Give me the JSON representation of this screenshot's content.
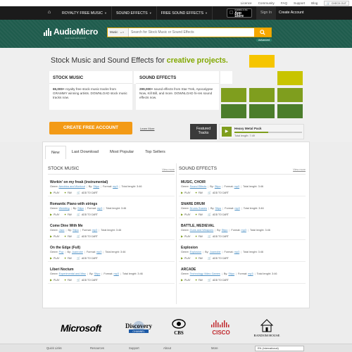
{
  "utility": {
    "links": [
      "Licence",
      "Community",
      "FAQ",
      "Support",
      "Blog"
    ],
    "cart_label": "CHECK OUT"
  },
  "nav": {
    "items": [
      "ROYALTY FREE MUSIC",
      "SOUND EFFECTS",
      "FREE SOUND EFFECTS"
    ],
    "appstore_small": "Available on the",
    "appstore_big": "App Store",
    "signin": "Sign In",
    "create": "Create Account"
  },
  "header": {
    "logo": "AudioMicro",
    "tagline": "stock music and sounds",
    "search_category": "Music",
    "search_placeholder": "Search for Stock Music or Sound Effects",
    "advanced": "Advanced"
  },
  "hero": {
    "title_prefix": "Stock Music and Sound Effects for ",
    "title_highlight": "creative projects.",
    "stock": {
      "heading": "STOCK MUSIC",
      "count": "65,000+",
      "body": " royalty free stock music tracks from GRAMMY winning artists. DOWNLOAD stock music tracks now."
    },
    "sfx": {
      "heading": "SOUND EFFECTS",
      "count": "299,000+",
      "body": " sound effects from Star Trek, Apocalypse Now, Kill Bill, and more. DOWNLOAD hi-res sound effects now."
    },
    "cta": "CREATE FREE ACCOUNT",
    "learn_more": "Learn More",
    "featured_1": "Featured",
    "featured_2": "Tracks",
    "player_title": "Heavy Metal Pack",
    "player_length": "Total length: 7:49",
    "player_progress": 0.5,
    "tile_colors": {
      "top": "#f6c500",
      "olive": "#7f9e1e",
      "green": "#4b7d2b",
      "yellow": "#c8c400"
    }
  },
  "tabs": [
    "New",
    "Last Download",
    "Most Popular",
    "Top Sellers"
  ],
  "stock_music": {
    "heading": "STOCK MUSIC",
    "view_more": "View more",
    "items": [
      {
        "title": "Workin' on my freak (instrumental)",
        "genre": "Aerobics and Workout",
        "by": "Stipo",
        "format": "mp3",
        "length": "3:46"
      },
      {
        "title": "Romantic Piano with strings",
        "genre": "Wedding",
        "by": "Stipo",
        "format": "mp3",
        "length": "3:46"
      },
      {
        "title": "Come Dine With Me",
        "genre": "Jazz",
        "by": "Stipo",
        "format": "mp3",
        "length": "3:46"
      },
      {
        "title": "On the Edge (Full)",
        "genre": "Pop",
        "by": "Juanrobe",
        "format": "mp3",
        "length": "3:46"
      },
      {
        "title": "Liberi Noctum",
        "genre": "Experimental and Misc",
        "by": "Stipo",
        "format": "mp3",
        "length": "3:46"
      }
    ]
  },
  "sound_effects": {
    "heading": "SOUND EFFECTS",
    "view_more": "View more",
    "items": [
      {
        "title": "MUSIC, CHOIR",
        "genre": "Sound Effects",
        "by": "Stipo",
        "format": "mp3",
        "length": "3:46"
      },
      {
        "title": "SNARE DRUM",
        "genre": "Drums Snares",
        "by": "Stipo",
        "format": "mp3",
        "length": "3:46"
      },
      {
        "title": "BATTLE, MEDIEVAL",
        "genre": "Guns and Weapons",
        "by": "Stipo",
        "format": "mp3",
        "length": "3:46"
      },
      {
        "title": "Explosion",
        "genre": "Explosion",
        "by": "Juanrobe",
        "format": "mp3",
        "length": "3:46"
      },
      {
        "title": "ARCADE",
        "genre": "Technology Video Games",
        "by": "Stipo",
        "format": "mp3",
        "length": "3:46"
      }
    ]
  },
  "labels": {
    "genre": "Genre:",
    "by": "By:",
    "format": "Format:",
    "total": "Total lenght:",
    "play": "PLAY",
    "fav": "FAV",
    "cart": "ADD TO CART"
  },
  "partners": {
    "microsoft": "Microsoft",
    "discovery": "Discovery",
    "discovery_sub": "CHANNEL",
    "cbs": "CBS",
    "cisco": "CISCO",
    "random_house": "RANDOM HOUSE"
  },
  "footer": {
    "cols": [
      "Quick Links",
      "Resources",
      "Support",
      "About",
      "More"
    ],
    "language": "EN (International)"
  }
}
